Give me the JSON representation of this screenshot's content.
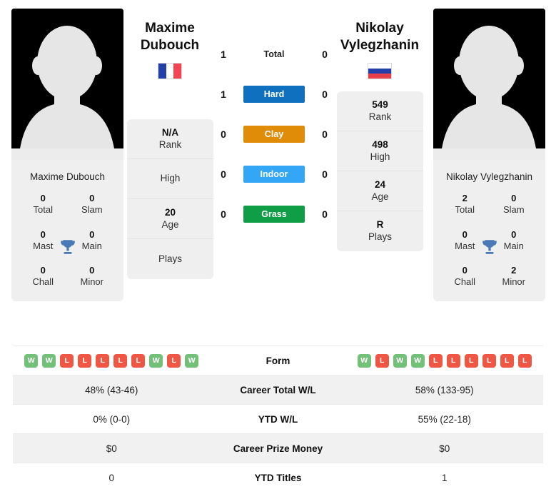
{
  "players": {
    "left": {
      "first_name": "Maxime",
      "last_name": "Dubouch",
      "full_name": "Maxime Dubouch",
      "country_code": "FR",
      "flag_name": "france-flag",
      "info": [
        {
          "value": "N/A",
          "label": "Rank"
        },
        {
          "value": "",
          "label": "High"
        },
        {
          "value": "20",
          "label": "Age"
        },
        {
          "value": "",
          "label": "Plays"
        }
      ],
      "titles": [
        {
          "value": "0",
          "label": "Total"
        },
        {
          "value": "0",
          "label": "Slam"
        },
        {
          "value": "0",
          "label": "Mast"
        },
        {
          "value": "0",
          "label": "Main"
        },
        {
          "value": "0",
          "label": "Chall"
        },
        {
          "value": "0",
          "label": "Minor"
        }
      ],
      "form": [
        "W",
        "W",
        "L",
        "L",
        "L",
        "L",
        "L",
        "W",
        "L",
        "W"
      ],
      "career_total_wl": "48% (43-46)",
      "ytd_wl": "0% (0-0)",
      "career_prize_money": "$0",
      "ytd_titles": "0"
    },
    "right": {
      "first_name": "Nikolay",
      "last_name": "Vylegzhanin",
      "full_name": "Nikolay Vylegzhanin",
      "country_code": "RU",
      "flag_name": "russia-flag",
      "info": [
        {
          "value": "549",
          "label": "Rank"
        },
        {
          "value": "498",
          "label": "High"
        },
        {
          "value": "24",
          "label": "Age"
        },
        {
          "value": "R",
          "label": "Plays"
        }
      ],
      "titles": [
        {
          "value": "2",
          "label": "Total"
        },
        {
          "value": "0",
          "label": "Slam"
        },
        {
          "value": "0",
          "label": "Mast"
        },
        {
          "value": "0",
          "label": "Main"
        },
        {
          "value": "0",
          "label": "Chall"
        },
        {
          "value": "2",
          "label": "Minor"
        }
      ],
      "form": [
        "W",
        "L",
        "W",
        "W",
        "L",
        "L",
        "L",
        "L",
        "L",
        "L"
      ],
      "career_total_wl": "58% (133-95)",
      "ytd_wl": "55% (22-18)",
      "career_prize_money": "$0",
      "ytd_titles": "1"
    }
  },
  "head_to_head": [
    {
      "label": "Total",
      "left": "1",
      "right": "0",
      "color": "transparent",
      "text_color": "#222222"
    },
    {
      "label": "Hard",
      "left": "1",
      "right": "0",
      "color": "#1070c0",
      "text_color": "#ffffff"
    },
    {
      "label": "Clay",
      "left": "0",
      "right": "0",
      "color": "#e08c09",
      "text_color": "#ffffff"
    },
    {
      "label": "Indoor",
      "left": "0",
      "right": "0",
      "color": "#33a6f5",
      "text_color": "#ffffff"
    },
    {
      "label": "Grass",
      "left": "0",
      "right": "0",
      "color": "#0f9d45",
      "text_color": "#ffffff"
    }
  ],
  "stats_rows": [
    {
      "label": "Form",
      "type": "form",
      "left": "",
      "right": ""
    },
    {
      "label": "Career Total W/L",
      "type": "text",
      "left": "48% (43-46)",
      "right": "58% (133-95)"
    },
    {
      "label": "YTD W/L",
      "type": "text",
      "left": "0% (0-0)",
      "right": "55% (22-18)"
    },
    {
      "label": "Career Prize Money",
      "type": "text",
      "left": "$0",
      "right": "$0"
    },
    {
      "label": "YTD Titles",
      "type": "text",
      "left": "0",
      "right": "1"
    }
  ],
  "colors": {
    "win_badge": "#73c178",
    "loss_badge": "#ef5643",
    "trophy": "#4a7ab5",
    "card_bg": "#efefef",
    "row_alt_bg": "#f1f1f1"
  }
}
